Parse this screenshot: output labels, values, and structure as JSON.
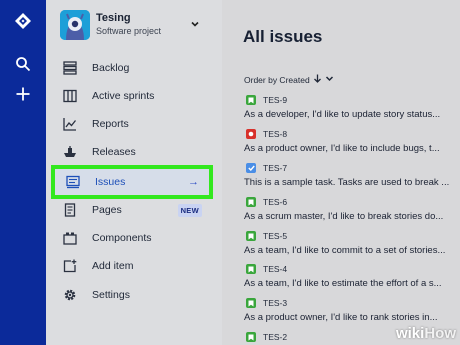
{
  "project": {
    "name": "Tesing",
    "type": "Software project"
  },
  "nav": {
    "backlog": "Backlog",
    "active_sprints": "Active sprints",
    "reports": "Reports",
    "releases": "Releases",
    "issues": "Issues",
    "pages": "Pages",
    "pages_badge": "NEW",
    "components": "Components",
    "add_item": "Add item",
    "settings": "Settings"
  },
  "main": {
    "title": "All issues",
    "order_by": "Order by Created"
  },
  "issues": [
    {
      "key": "TES-9",
      "type": "story",
      "summary": "As a developer, I'd like to update story status..."
    },
    {
      "key": "TES-8",
      "type": "bug",
      "summary": "As a product owner, I'd like to include bugs, t..."
    },
    {
      "key": "TES-7",
      "type": "task",
      "summary": "This is a sample task. Tasks are used to break ..."
    },
    {
      "key": "TES-6",
      "type": "story",
      "summary": "As a scrum master, I'd like to break stories do..."
    },
    {
      "key": "TES-5",
      "type": "story",
      "summary": "As a team, I'd like to commit to a set of stories..."
    },
    {
      "key": "TES-4",
      "type": "story",
      "summary": "As a team, I'd like to estimate the effort of a s..."
    },
    {
      "key": "TES-3",
      "type": "story",
      "summary": "As a product owner, I'd like to rank stories in..."
    },
    {
      "key": "TES-2",
      "type": "story",
      "summary": ""
    }
  ],
  "colors": {
    "global_bar": "#0b2a9a",
    "highlight": "#32e81e",
    "story": "#3aa63c",
    "bug": "#d8312b",
    "task": "#4a8ee6"
  },
  "watermark": {
    "wiki": "wiki",
    "how": "How"
  }
}
